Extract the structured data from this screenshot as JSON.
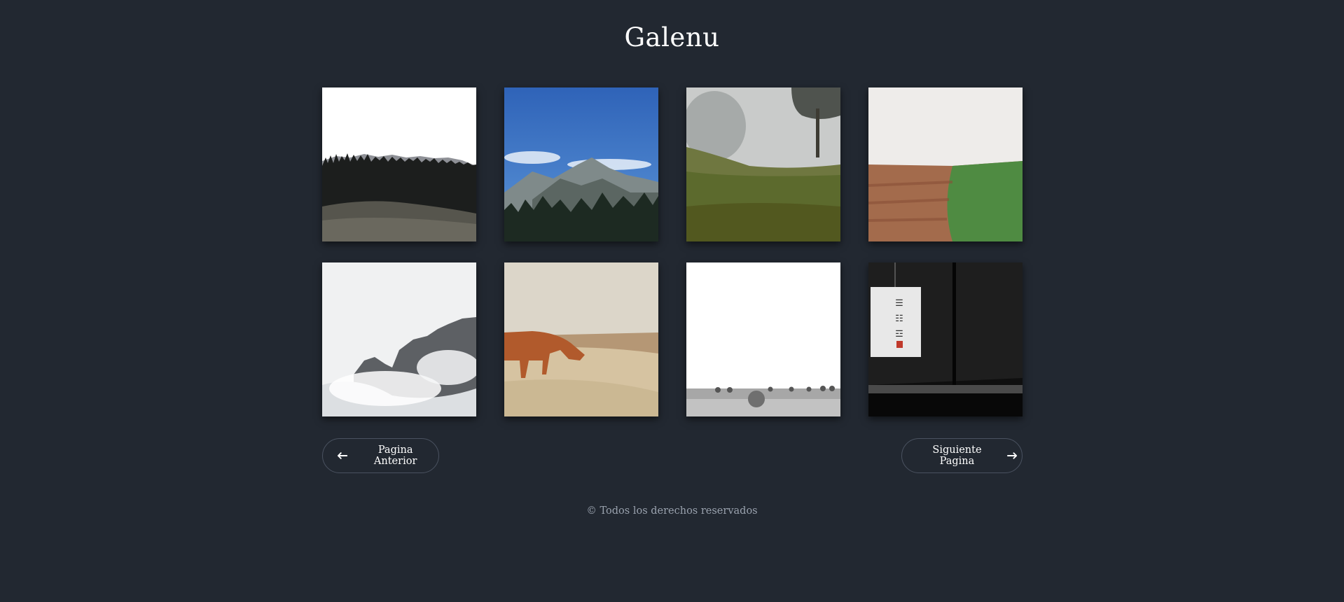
{
  "site": {
    "title": "Galenu"
  },
  "gallery": {
    "images": [
      {
        "subject": "pine forest and meadow under white sky"
      },
      {
        "subject": "rocky mountain peak under blue sky"
      },
      {
        "subject": "foggy green hillside with tree"
      },
      {
        "subject": "plowed brown field beside green field"
      },
      {
        "subject": "misty mountain cliffs in clouds"
      },
      {
        "subject": "highland cow on rocky terrain"
      },
      {
        "subject": "hay bales on field under white sky"
      },
      {
        "subject": "paper lantern with calligraphy in dark room"
      }
    ]
  },
  "pagination": {
    "prev_label": "Pagina Anterior",
    "next_label": "Siguiente Pagina",
    "prev_icon": "arrow-left-icon",
    "next_icon": "arrow-right-icon"
  },
  "footer": {
    "text": "© Todos los derechos reservados"
  },
  "colors": {
    "background": "#222831",
    "button_border": "#4a5260",
    "footer_text": "#9aa2ae"
  }
}
